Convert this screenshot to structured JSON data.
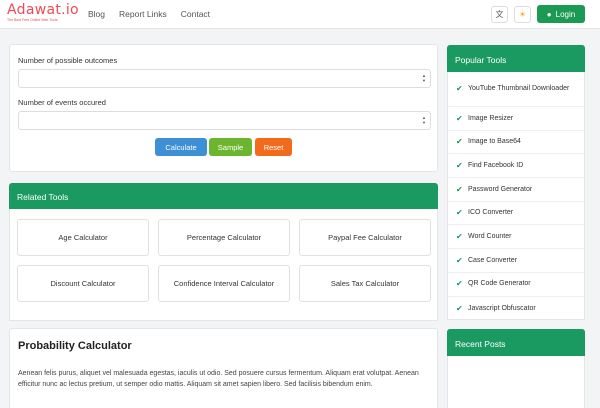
{
  "header": {
    "logo_main": "Adawat.io",
    "logo_tagline": "The Best Free Online Web Tools",
    "nav": [
      "Blog",
      "Report Links",
      "Contact"
    ],
    "login_label": "Login",
    "brand_color": "#ef4a55",
    "accent_color": "#1a9a52"
  },
  "calculator": {
    "field1_label": "Number of possible outcomes",
    "field1_value": "",
    "field2_label": "Number of events occured",
    "field2_value": "",
    "buttons": {
      "calculate": "Calculate",
      "sample": "Sample",
      "reset": "Reset"
    },
    "button_colors": {
      "calculate": "#3d8fd6",
      "sample": "#6cb52e",
      "reset": "#f26b1d"
    }
  },
  "related": {
    "title": "Related Tools",
    "tools": [
      "Age Calculator",
      "Percentage Calculator",
      "Paypal Fee Calculator",
      "Discount Calculator",
      "Confidence Interval Calculator",
      "Sales Tax Calculator"
    ]
  },
  "article": {
    "title": "Probability Calculator",
    "text": "Aenean felis purus, aliquet vel malesuada egestas, iaculis ut odio. Sed posuere cursus fermentum. Aliquam erat volutpat. Aenean efficitur nunc ac lectus pretium, ut semper odio mattis. Aliquam sit amet sapien libero. Sed facilisis bibendum enim."
  },
  "sidebar": {
    "popular_title": "Popular Tools",
    "items": [
      "YouTube Thumbnail Downloader",
      "Image Resizer",
      "Image to Base64",
      "Find Facebook ID",
      "Password Generator",
      "ICO Converter",
      "Word Counter",
      "Case Converter",
      "QR Code Generator",
      "Javascript Obfuscator"
    ],
    "recent_title": "Recent Posts"
  }
}
